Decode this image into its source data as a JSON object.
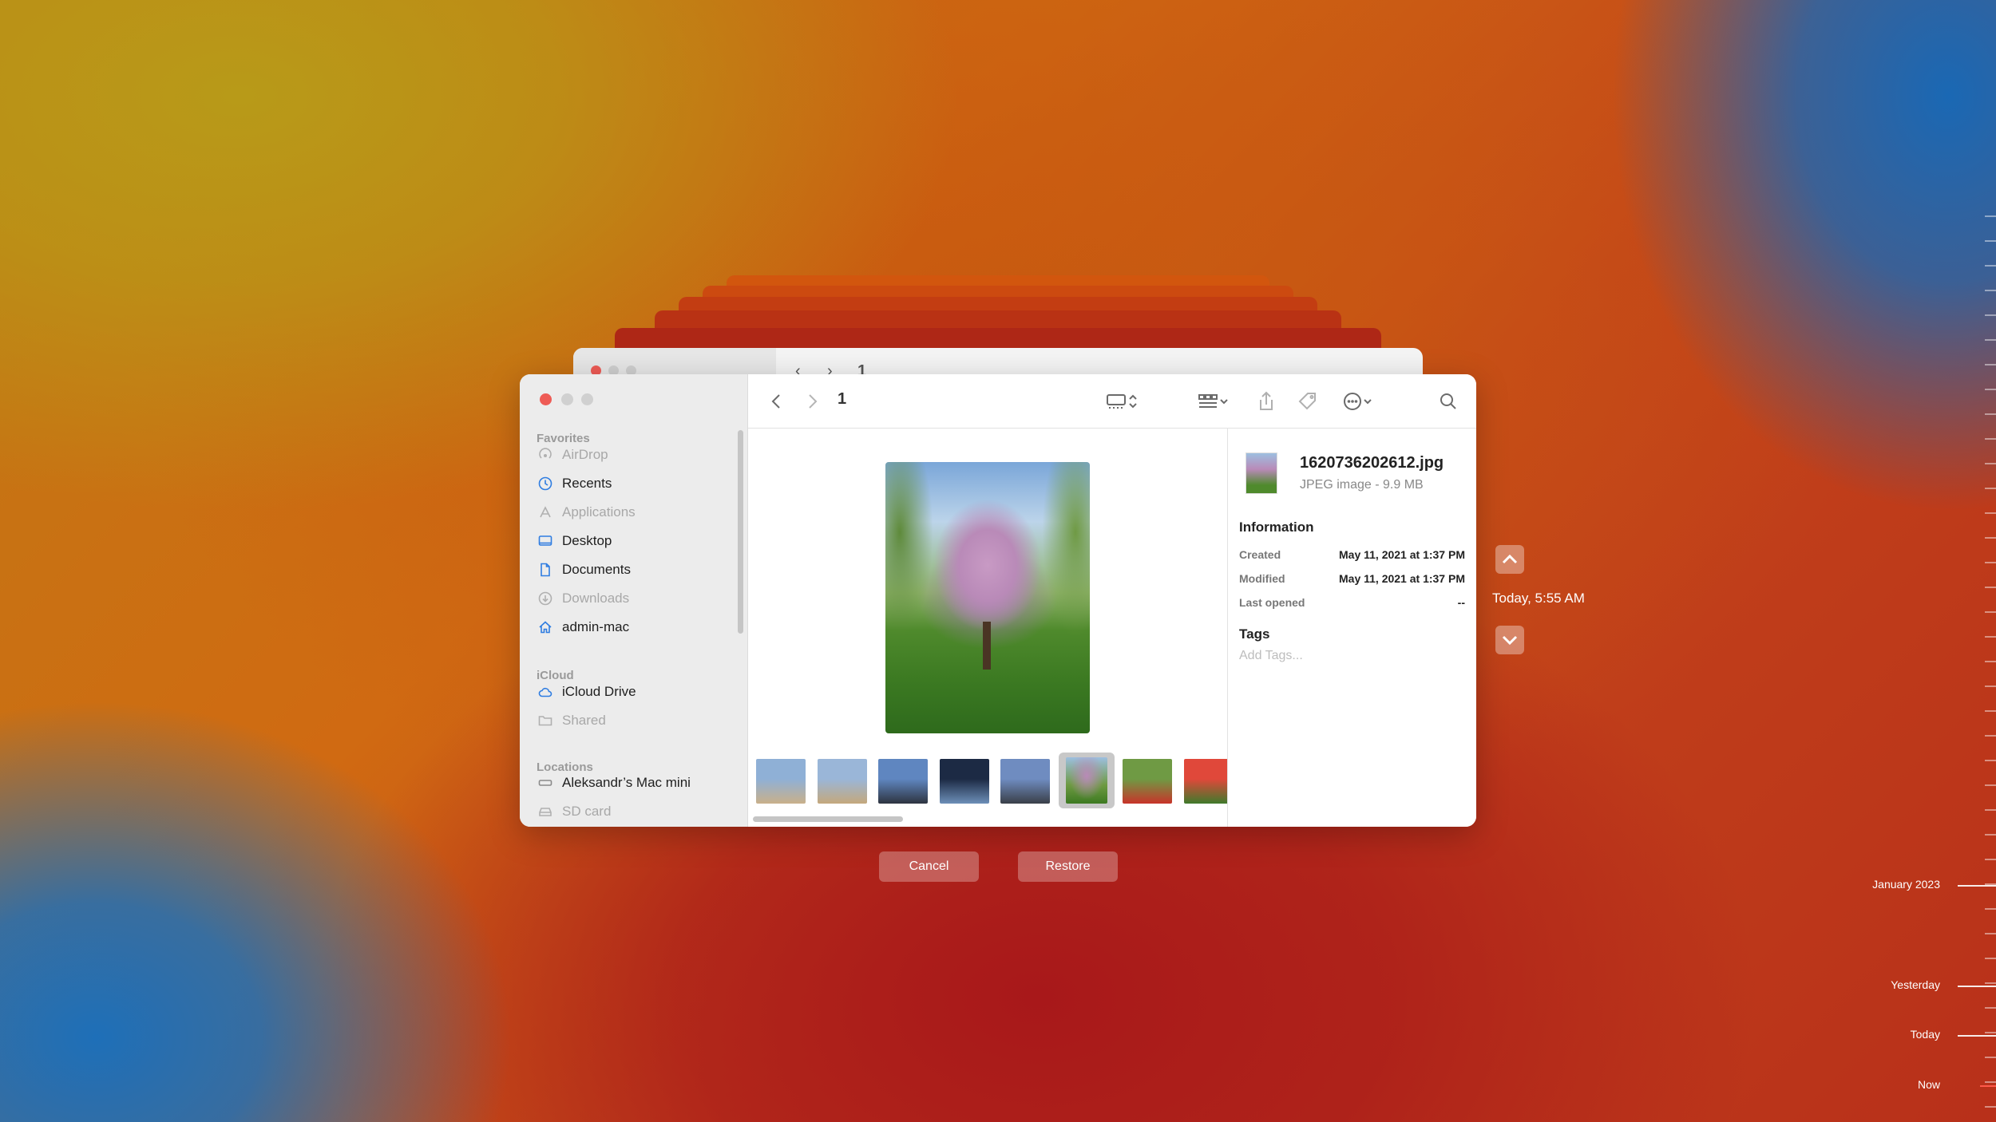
{
  "back_window": {
    "path": "1"
  },
  "finder": {
    "path_title": "1",
    "sidebar": {
      "favorites_heading": "Favorites",
      "favorites": [
        {
          "label": "AirDrop",
          "icon": "airdrop-icon",
          "dim": true
        },
        {
          "label": "Recents",
          "icon": "clock-icon",
          "dim": false
        },
        {
          "label": "Applications",
          "icon": "applications-icon",
          "dim": true
        },
        {
          "label": "Desktop",
          "icon": "desktop-icon",
          "dim": false
        },
        {
          "label": "Documents",
          "icon": "document-icon",
          "dim": false
        },
        {
          "label": "Downloads",
          "icon": "download-icon",
          "dim": true
        },
        {
          "label": "admin-mac",
          "icon": "home-icon",
          "dim": false
        }
      ],
      "icloud_heading": "iCloud",
      "icloud": [
        {
          "label": "iCloud Drive",
          "icon": "cloud-icon",
          "dim": false
        },
        {
          "label": "Shared",
          "icon": "shared-folder-icon",
          "dim": true
        }
      ],
      "locations_heading": "Locations",
      "locations": [
        {
          "label": "Aleksandr’s Mac mini",
          "icon": "computer-icon",
          "dim": false
        },
        {
          "label": "SD card",
          "icon": "drive-icon",
          "dim": true
        }
      ]
    },
    "info": {
      "file_name": "1620736202612.jpg",
      "file_type": "JPEG image - 9.9 MB",
      "information_heading": "Information",
      "rows": [
        {
          "key": "Created",
          "value": "May 11, 2021 at 1:37 PM"
        },
        {
          "key": "Modified",
          "value": "May 11, 2021 at 1:37 PM"
        },
        {
          "key": "Last opened",
          "value": "--"
        }
      ],
      "tags_heading": "Tags",
      "tags_placeholder": "Add Tags..."
    },
    "thumbnails": [
      {
        "colors": [
          "#8fb0d6",
          "#c9b08a"
        ]
      },
      {
        "colors": [
          "#9ab6d8",
          "#c4a87c"
        ]
      },
      {
        "colors": [
          "#5f86c0",
          "#2e3440"
        ]
      },
      {
        "colors": [
          "#1c2a44",
          "#6d8fb8"
        ]
      },
      {
        "colors": [
          "#6f8cc0",
          "#3a3f48"
        ]
      },
      {
        "colors": [
          "#9dbfe0",
          "#b98ab8"
        ]
      },
      {
        "colors": [
          "#6f9a44",
          "#c8342a"
        ]
      },
      {
        "colors": [
          "#e0483a",
          "#3f7a2c"
        ]
      }
    ],
    "selected_thumbnail": 5
  },
  "time_machine": {
    "current_time": "Today, 5:55 AM",
    "cancel_label": "Cancel",
    "restore_label": "Restore",
    "timeline_labels": [
      "January 2023",
      "Yesterday",
      "Today",
      "Now"
    ]
  }
}
